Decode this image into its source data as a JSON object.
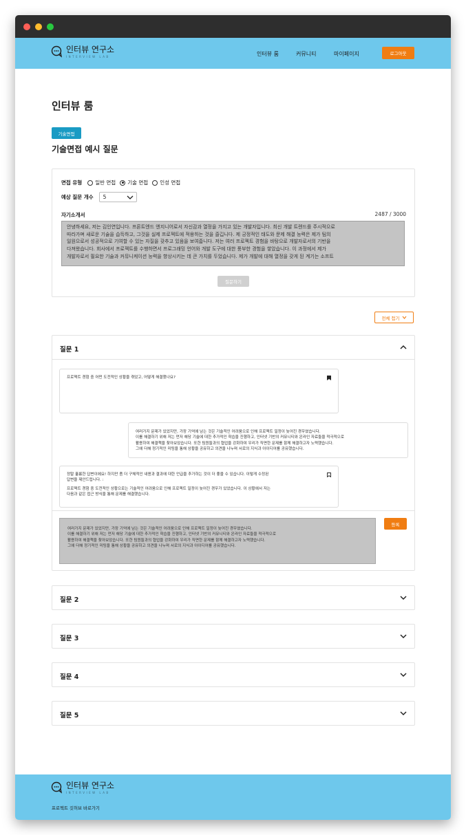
{
  "brand": {
    "name": "인터뷰 연구소",
    "sub": "INTERVIEW LAB"
  },
  "nav": {
    "items": [
      "인터뷰 룸",
      "커뮤니티",
      "마이페이지"
    ],
    "logout": "로그아웃"
  },
  "page": {
    "title": "인터뷰 룸",
    "badge": "기술면접",
    "subtitle": "기술면접 예시 질문"
  },
  "form": {
    "type_label": "면접 유형",
    "type_options": [
      "일반 면접",
      "기술 면접",
      "인성 면접"
    ],
    "type_selected": "기술 면접",
    "count_label": "예상 질문 개수",
    "count_value": "5",
    "intro_label": "자기소개서",
    "char_count": "2487 / 3000",
    "intro_lines": [
      "안녕하세요, 저는 김인연입니다. 프론트엔드 엔지니어로서 자신감과 열정을 가지고 있는 개발자입니다. 최신 개발 트렌드를 주시적으로",
      "따라가며 새로운 기술을 습득하고, 그것을 실제 프로젝트에 적용하는 것을 즐깁니다. 제 긍정적인 태도와 문제 해결 능력은 제가 팀의",
      "일원으로서 성공적으로 기여할 수 있는 자질을 갖추고 있음을 보여줍니다. 저는 여러 프로젝트 경험을 바탕으로 개발자로서의 기반을",
      "다져왔습니다. 회사에서 프로젝트를 수행하면서 프로그래밍 언어와 개발 도구에 대한 풍부한 경험을 쌓았습니다. 이 과정에서 제가",
      "개발자로서 필요한 기술과 커뮤니케이션 능력을 향상시키는 데 큰 가치를 두었습니다. 제가 개발에 대해 열정을 갖게 된 계기는 소프트"
    ],
    "ask_button": "질문하기"
  },
  "collapse_all": "전체 접기",
  "question1": {
    "title": "질문 1",
    "question": "프로젝트 경험 중 어떤 도전적인 상황을 겪었고, 어떻게 해결했나요?",
    "answer_lines": [
      "여러가지 문제가 있었지만, 가장 기억에 남는 것은 기술적인 어려움으로 인해 프로젝트 일정이 늦어진 경우였습니다.",
      "이를 해결하기 위해 저는 먼저 해당 기술에 대한 추가적인 학습을 진행하고, 인터넷 기반의 커뮤니티와 온라인 자료들을 적극적으로",
      "활용하여 해결책을 찾아보았습니다. 또한 팀원들과의 협업을 강화하여 우리가 직면한 문제를 함께 해결하고자 노력했습니다.",
      "그에 더해 정기적인 미팅을 통해 상황을 공유하고 의견을 나누며 서로의 지식과 아이디어를 공유했습니다."
    ],
    "feedback_lines": [
      "정말 훌륭한 답변이에요! 하지만 좀 더 구체적인 내용과 결과에 대한 언급을 추가하는 것이 더 좋을 수 있습니다. 이렇게 수정된",
      "답변을 제안드립니다. :",
      "",
      "프로젝트 경험 중 도전적인 상황으로는 기술적인 어려움으로 인해 프로젝트 일정이 늦어진 경우가 있었습니다. 이 상황에서 저는",
      "다음과 같은 접근 방식을 통해 문제를 해결했습니다."
    ],
    "input_lines": [
      "여러가지 문제가 있었지만, 가장 기억에 남는 것은 기술적인 어려움으로 인해 프로젝트 일정이 늦어진 경우였습니다.",
      "이를 해결하기 위해 저는 먼저 해당 기술에 대한 추가적인 학습을 진행하고, 인터넷 기반의 커뮤니티와 온라인 자료들을 적극적으로",
      "활용하여 해결책을 찾아보았습니다. 또한 팀원들과의 협업을 강화하여 우리가 직면한 문제를 함께 해결하고자 노력했습니다.",
      "그에 더해 정기적인 미팅을 통해 상황을 공유하고 의견을 나누며 서로의 지식과 아이디어를 공유했습니다."
    ],
    "submit": "등록"
  },
  "questions_closed": [
    "질문 2",
    "질문 3",
    "질문 4",
    "질문 5"
  ],
  "footer": {
    "link": "프로젝트 깃허브 바로가기"
  }
}
